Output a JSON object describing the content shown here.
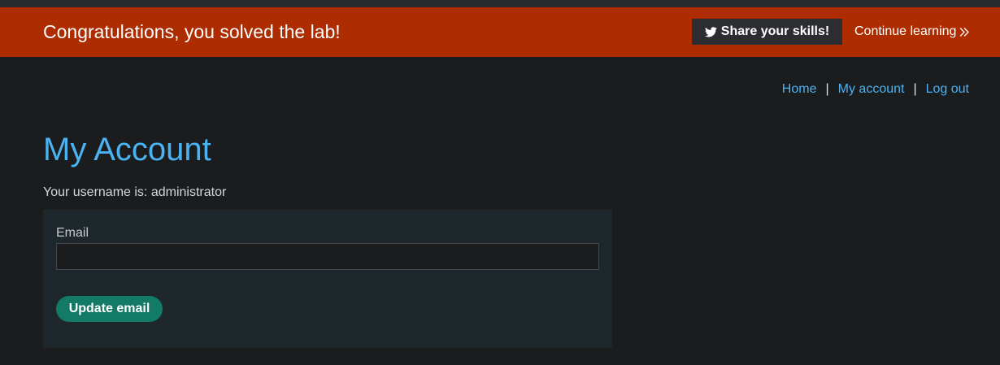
{
  "banner": {
    "title": "Congratulations, you solved the lab!",
    "share_label": "Share your skills!",
    "share_icon": "twitter-bird-icon",
    "continue_label": "Continue learning",
    "continue_icon": "double-chevron-right-icon",
    "background_color": "#ad2c00"
  },
  "nav": {
    "home": "Home",
    "separator": "|",
    "my_account": "My account",
    "log_out": "Log out"
  },
  "main": {
    "title": "My Account",
    "username_text": "Your username is: administrator"
  },
  "form": {
    "email_label": "Email",
    "email_value": "",
    "submit_label": "Update email",
    "accent_color": "#137a65"
  },
  "colors": {
    "link": "#4cb3f3",
    "page_background": "#1a1c1e",
    "panel_background": "#1e282c"
  }
}
